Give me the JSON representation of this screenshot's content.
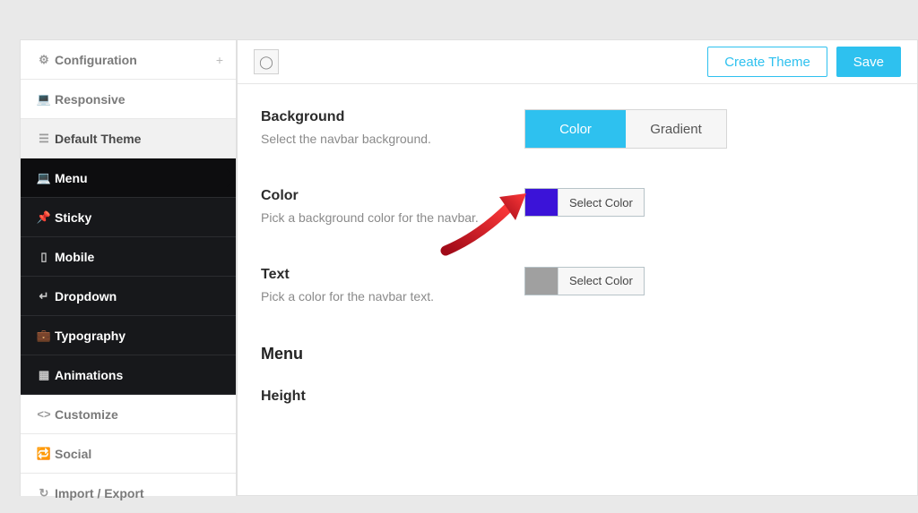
{
  "colors": {
    "accent": "#2ec1ef",
    "swatch_bg": "#3b13d8",
    "swatch_text": "#a0a0a0",
    "arrow": "#d51121"
  },
  "sidebar": {
    "items": [
      {
        "label": "Configuration",
        "icon": "gear",
        "kind": "group",
        "plus": "+"
      },
      {
        "label": "Responsive",
        "icon": "monitor",
        "kind": "normal"
      },
      {
        "label": "Default Theme",
        "icon": "list",
        "kind": "section"
      },
      {
        "label": "Menu",
        "icon": "monitor",
        "kind": "dark active"
      },
      {
        "label": "Sticky",
        "icon": "pin",
        "kind": "dark"
      },
      {
        "label": "Mobile",
        "icon": "phone",
        "kind": "dark"
      },
      {
        "label": "Dropdown",
        "icon": "return",
        "kind": "dark"
      },
      {
        "label": "Typography",
        "icon": "case",
        "kind": "dark"
      },
      {
        "label": "Animations",
        "icon": "film",
        "kind": "dark"
      },
      {
        "label": "Customize",
        "icon": "code",
        "kind": "normal"
      },
      {
        "label": "Social",
        "icon": "share",
        "kind": "normal"
      },
      {
        "label": "Import / Export",
        "icon": "refresh",
        "kind": "normal"
      }
    ]
  },
  "toolbar": {
    "create_theme": "Create Theme",
    "save": "Save"
  },
  "settings": {
    "background": {
      "title": "Background",
      "desc": "Select the navbar background.",
      "options": [
        "Color",
        "Gradient"
      ],
      "active": 0
    },
    "color": {
      "title": "Color",
      "desc": "Pick a background color for the navbar.",
      "button": "Select Color"
    },
    "text": {
      "title": "Text",
      "desc": "Pick a color for the navbar text.",
      "button": "Select Color"
    },
    "menu_section": "Menu",
    "height_label": "Height"
  }
}
